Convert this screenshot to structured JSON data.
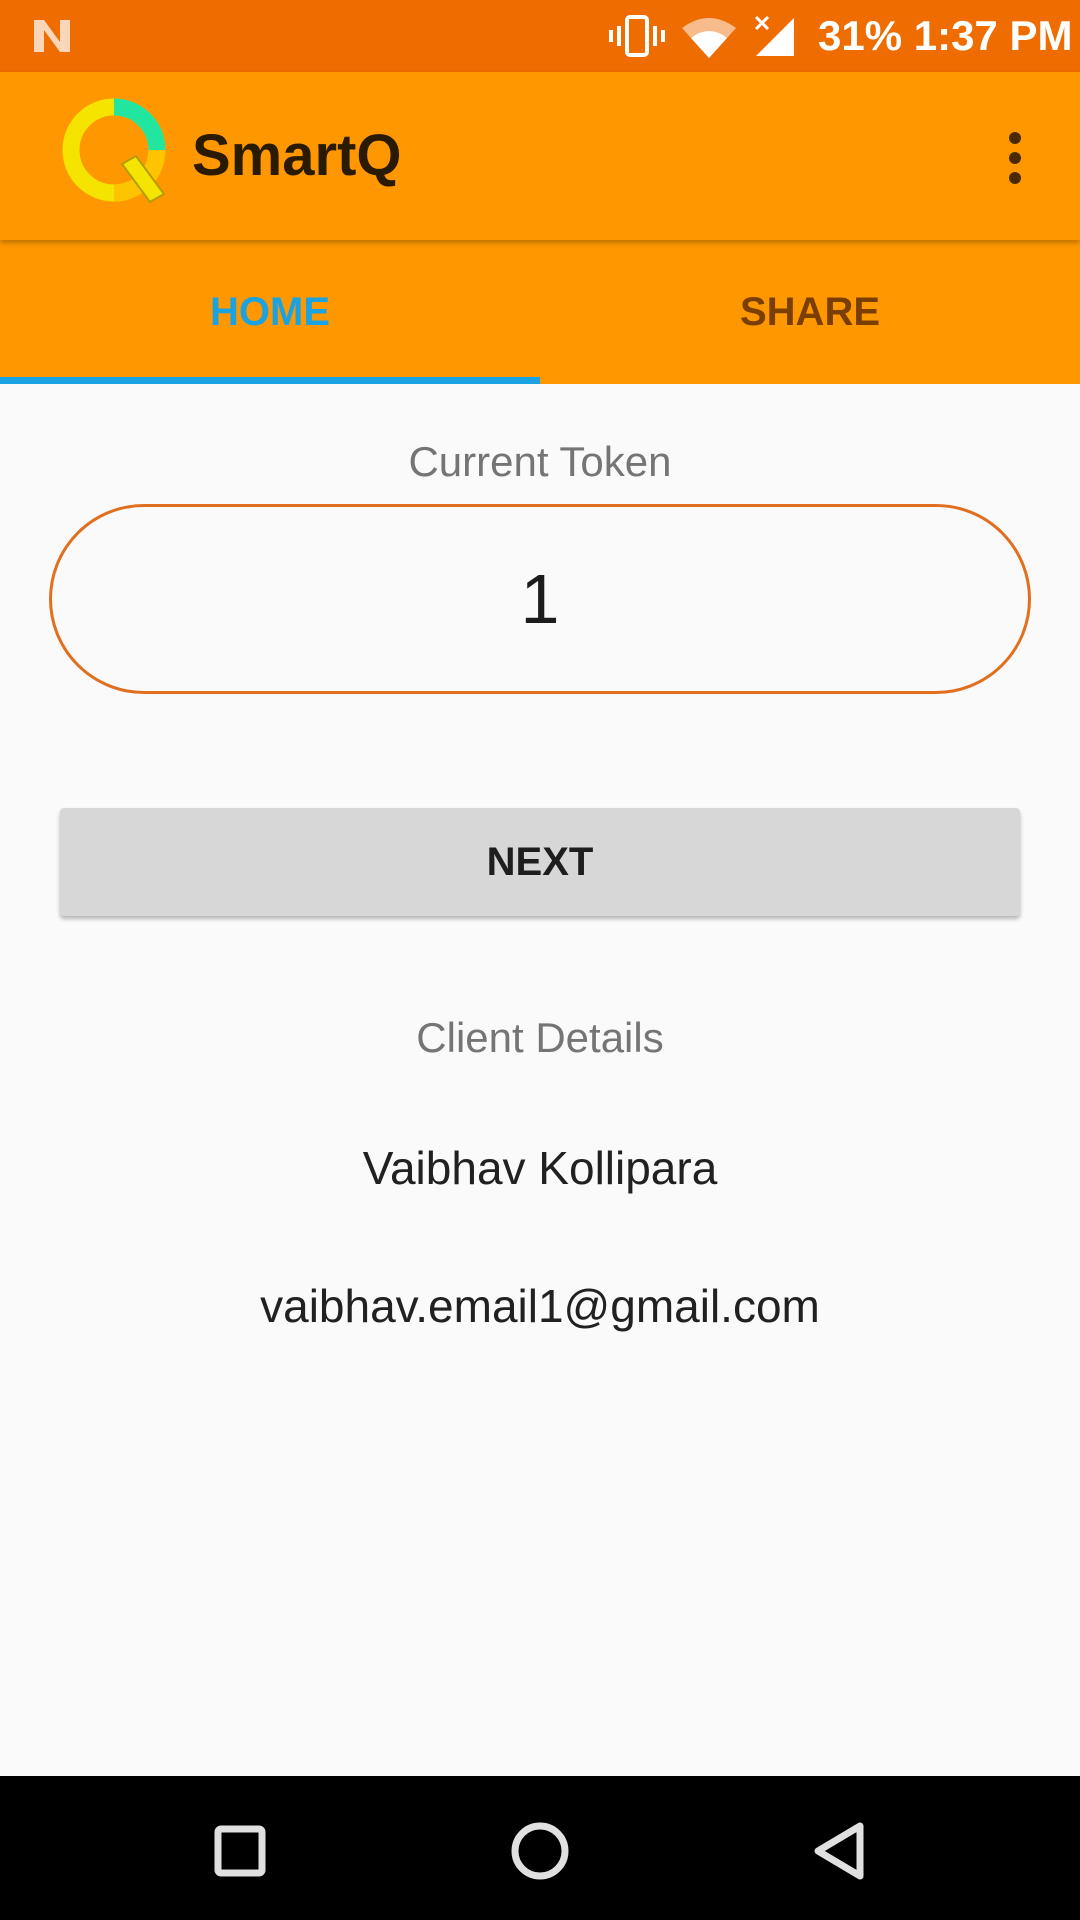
{
  "status_bar": {
    "battery": "31%",
    "time": "1:37 PM",
    "text": "31% 1:37 PM"
  },
  "app_bar": {
    "title": "SmartQ",
    "logo_colors": [
      "#f4e400",
      "#ffc400",
      "#22e5a0"
    ],
    "background": "#ff9800"
  },
  "tabs": [
    {
      "label": "HOME",
      "active": true
    },
    {
      "label": "SHARE",
      "active": false
    }
  ],
  "main": {
    "current_token_label": "Current Token",
    "current_token_value": "1",
    "next_button_label": "NEXT",
    "client_details_label": "Client Details",
    "client_name": "Vaibhav Kollipara",
    "client_email": "vaibhav.email1@gmail.com"
  },
  "colors": {
    "status_bar": "#ef6c00",
    "accent": "#1aa3e0",
    "token_border": "#e07020"
  },
  "icons": {
    "status": [
      "notification-n-icon",
      "vibrate-icon",
      "wifi-icon",
      "cell-signal-icon"
    ],
    "navigation": [
      "recents-icon",
      "home-icon",
      "back-icon"
    ],
    "menu": "overflow-menu-icon"
  }
}
